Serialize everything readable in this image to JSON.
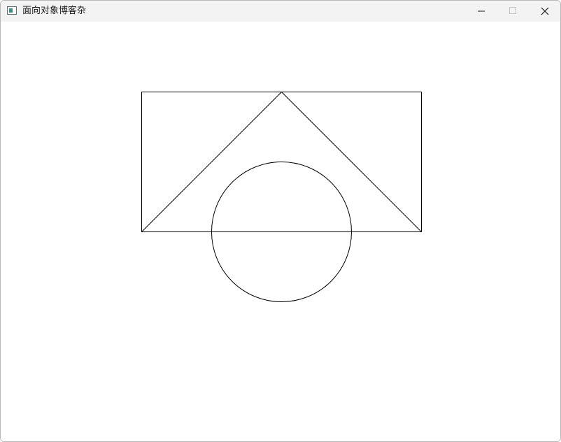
{
  "window": {
    "title": "面向对象博客杂",
    "controls": {
      "minimize_icon": "minimize-icon",
      "maximize_icon": "maximize-icon",
      "close_icon": "close-icon"
    }
  },
  "canvas": {
    "background": "#ffffff",
    "stroke": "#000000",
    "shapes": [
      "rectangle",
      "triangle",
      "circle"
    ]
  }
}
